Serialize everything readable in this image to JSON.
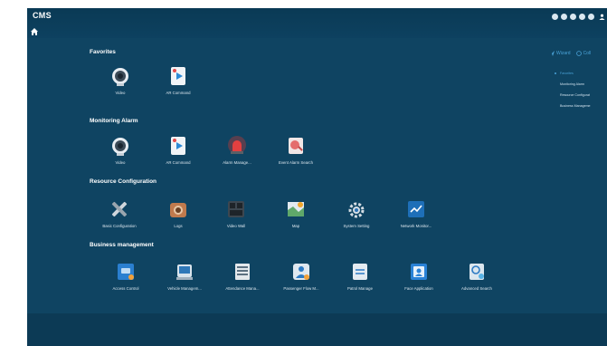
{
  "app": {
    "title": "CMS"
  },
  "sections": [
    {
      "title": "Favorites",
      "tiles": [
        {
          "label": "Video",
          "icon": "video-camera-icon"
        },
        {
          "label": "AR Command",
          "icon": "ar-command-icon"
        }
      ]
    },
    {
      "title": "Monitoring Alarm",
      "tiles": [
        {
          "label": "Video",
          "icon": "video-camera-icon"
        },
        {
          "label": "AR Command",
          "icon": "ar-command-icon"
        },
        {
          "label": "Alarm Manage...",
          "icon": "alarm-siren-icon"
        },
        {
          "label": "Event Alarm Search",
          "icon": "event-alarm-search-icon"
        }
      ]
    },
    {
      "title": "Resource Configuration",
      "tiles": [
        {
          "label": "Basic Configuration",
          "icon": "tools-icon"
        },
        {
          "label": "Logs",
          "icon": "logs-camera-icon"
        },
        {
          "label": "Video Wall",
          "icon": "video-wall-icon"
        },
        {
          "label": "Map",
          "icon": "map-icon"
        },
        {
          "label": "System Setting",
          "icon": "gear-icon"
        },
        {
          "label": "Network Monitor...",
          "icon": "network-monitor-icon"
        }
      ]
    },
    {
      "title": "Business management",
      "tiles": [
        {
          "label": "Access Control",
          "icon": "access-control-icon"
        },
        {
          "label": "Vehicle Managem...",
          "icon": "vehicle-management-icon"
        },
        {
          "label": "Attendance Mana...",
          "icon": "attendance-icon"
        },
        {
          "label": "Passenger Flow M...",
          "icon": "passenger-flow-icon"
        },
        {
          "label": "Patrol Manage",
          "icon": "patrol-icon"
        },
        {
          "label": "Face Application",
          "icon": "face-application-icon"
        },
        {
          "label": "Advanced Search",
          "icon": "advanced-search-icon"
        }
      ]
    }
  ],
  "side_panel": {
    "actions": [
      {
        "label": "Wizard",
        "icon": "wizard-icon"
      },
      {
        "label": "Coll",
        "icon": "collection-icon"
      }
    ],
    "menu": [
      "Favorites",
      "Monitoring Alarm",
      "Resource Configurat",
      "Business Manageme"
    ]
  }
}
